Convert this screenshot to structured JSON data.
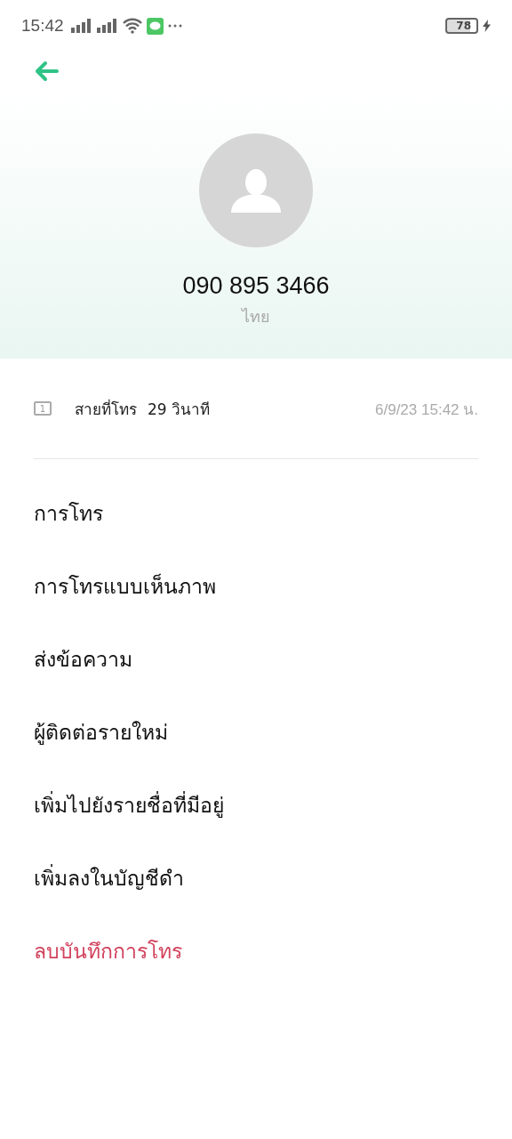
{
  "status_bar": {
    "time": "15:42",
    "battery": "78"
  },
  "contact": {
    "number": "090 895 3466",
    "location": "ไทย"
  },
  "call_log": {
    "sim": "1",
    "type": "สายที่โทร",
    "duration": "29 วินาที",
    "datetime": "6/9/23 15:42 น."
  },
  "actions": [
    {
      "label": "การโทร",
      "kind": "normal"
    },
    {
      "label": "การโทรแบบเห็นภาพ",
      "kind": "normal"
    },
    {
      "label": "ส่งข้อความ",
      "kind": "normal"
    },
    {
      "label": "ผู้ติดต่อรายใหม่",
      "kind": "normal"
    },
    {
      "label": "เพิ่มไปยังรายชื่อที่มีอยู่",
      "kind": "normal"
    },
    {
      "label": "เพิ่มลงในบัญชีดำ",
      "kind": "normal"
    },
    {
      "label": "ลบบันทึกการโทร",
      "kind": "danger"
    }
  ]
}
